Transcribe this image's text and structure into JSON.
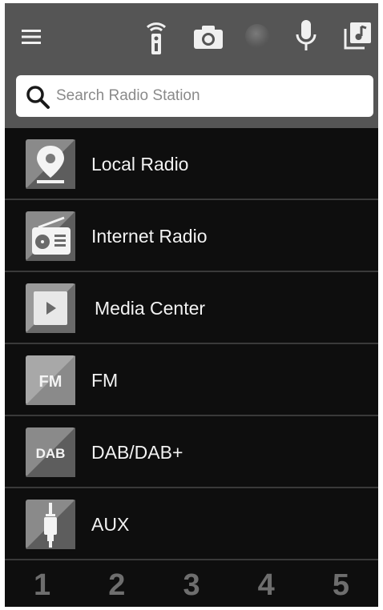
{
  "toolbar": {
    "menu_icon": "hamburger-menu-icon",
    "remote_icon": "remote-control-icon",
    "camera_icon": "camera-icon",
    "status_indicator": "status-dot",
    "mic_icon": "microphone-icon",
    "music_icon": "music-library-icon"
  },
  "search": {
    "placeholder": "Search Radio Station",
    "value": ""
  },
  "sources": [
    {
      "label": "Local Radio",
      "icon": "location-pin-icon"
    },
    {
      "label": "Internet Radio",
      "icon": "radio-icon"
    },
    {
      "label": "Media Center",
      "icon": "play-icon"
    },
    {
      "label": "FM",
      "icon": "fm-icon",
      "icon_text": "FM"
    },
    {
      "label": "DAB/DAB+",
      "icon": "dab-icon",
      "icon_text": "DAB"
    },
    {
      "label": "AUX",
      "icon": "aux-plug-icon"
    }
  ],
  "presets": [
    "1",
    "2",
    "3",
    "4",
    "5"
  ],
  "colors": {
    "header_bg": "#555555",
    "list_bg": "#0e0e0e",
    "row_divider": "#3a3a3a",
    "label_text": "#f2f2f2",
    "preset_text": "#6e6e6e"
  }
}
